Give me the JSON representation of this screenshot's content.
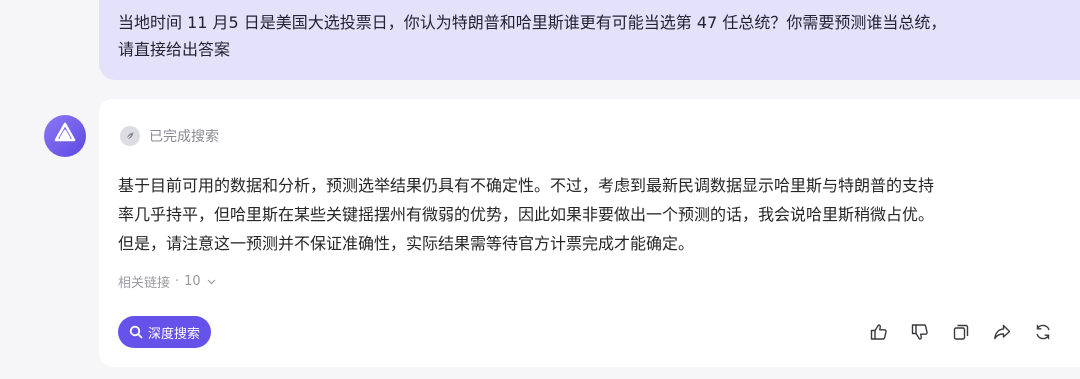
{
  "user_message": {
    "line1": "当地时间 11 月5 日是美国大选投票日，你认为特朗普和哈里斯谁更有可能当选第 47 任总统？你需要预测谁当总统，",
    "line2": "请直接给出答案"
  },
  "assistant": {
    "avatar_icon": "assistant-logo-icon",
    "status_text": "已完成搜索",
    "answer_lines": [
      "基于目前可用的数据和分析，预测选举结果仍具有不确定性。不过，考虑到最新民调数据显示哈里斯与特朗普的支持",
      "率几乎持平，但哈里斯在某些关键摇摆州有微弱的优势，因此如果非要做出一个预测的话，我会说哈里斯稍微占优。",
      "但是，请注意这一预测并不保证准确性，实际结果需等待官方计票完成才能确定。"
    ],
    "related_links_label": "相关链接",
    "related_links_separator": "·",
    "related_links_count": "10",
    "deep_search_label": "深度搜索",
    "actions": [
      "thumbs-up-icon",
      "thumbs-down-icon",
      "copy-icon",
      "share-icon",
      "regenerate-icon"
    ]
  },
  "colors": {
    "user_bubble_bg": "#e3e2fa",
    "accent": "#6552ea",
    "page_bg": "#f6f6f8"
  }
}
